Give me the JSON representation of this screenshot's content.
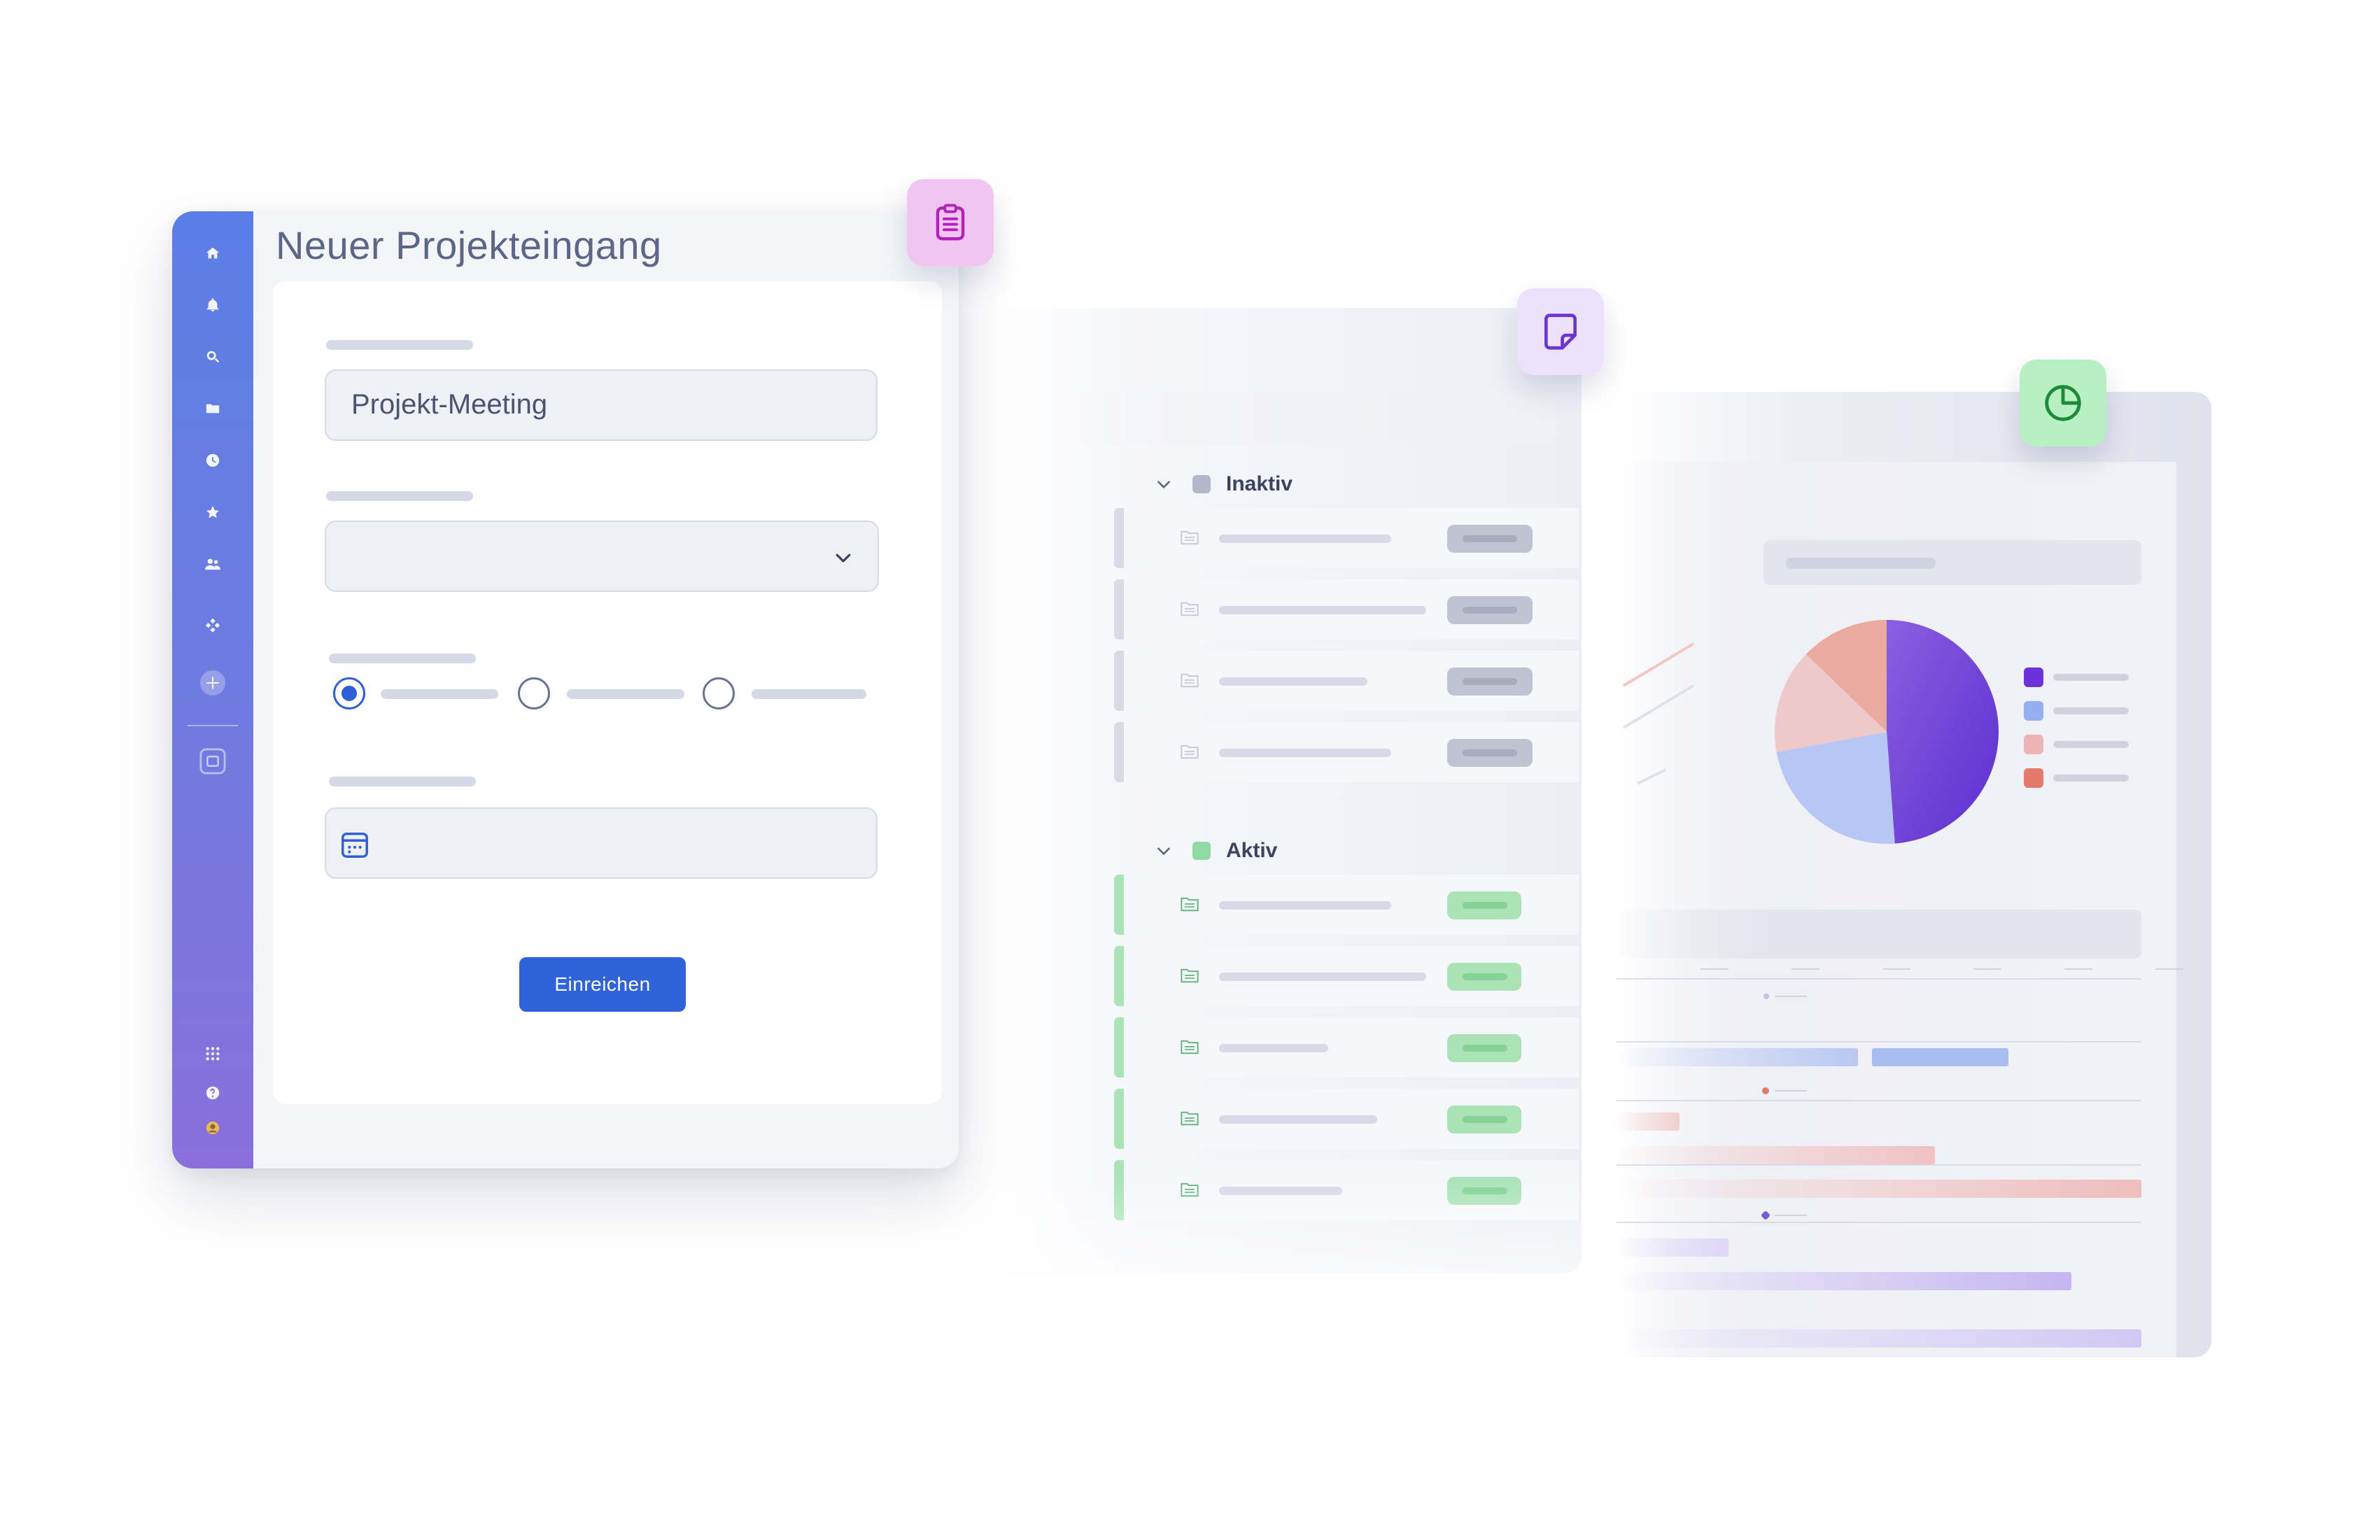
{
  "form": {
    "title": "Neuer Projekteingang",
    "project_name_value": "Projekt-Meeting",
    "submit_label": "Einreichen",
    "radio_selected_index": 0
  },
  "sidebar": {
    "icons": [
      "home-icon",
      "bell-icon",
      "search-icon",
      "folder-icon",
      "clock-icon",
      "star-icon",
      "users-icon",
      "apps-icon",
      "add-icon",
      "calendar-icon",
      "grid-icon",
      "help-icon",
      "avatar-icon"
    ]
  },
  "list": {
    "groups": [
      {
        "label": "Inaktiv",
        "color": "#b3b8c9",
        "rows": 4
      },
      {
        "label": "Aktiv",
        "color": "#8fd9a4",
        "rows": 5
      }
    ]
  },
  "badges": {
    "form_badge": {
      "icon": "clipboard-icon",
      "color": "#f1c5f2"
    },
    "note_badge": {
      "icon": "note-icon",
      "color": "#ece0fb"
    },
    "chart_badge": {
      "icon": "pie-chart-icon",
      "color": "#b7f0c2"
    }
  },
  "colors": {
    "accent": "#2f62db",
    "sidebar_top": "#5a7ee6",
    "sidebar_bottom": "#8a6fdc"
  },
  "chart_data": {
    "type": "pie",
    "title": "",
    "series": [
      {
        "values": [
          42,
          20,
          13,
          11
        ],
        "colors": [
          "#6d44d6",
          "#b8c6f6",
          "#eec9c9",
          "#e9aaa0"
        ]
      }
    ]
  }
}
